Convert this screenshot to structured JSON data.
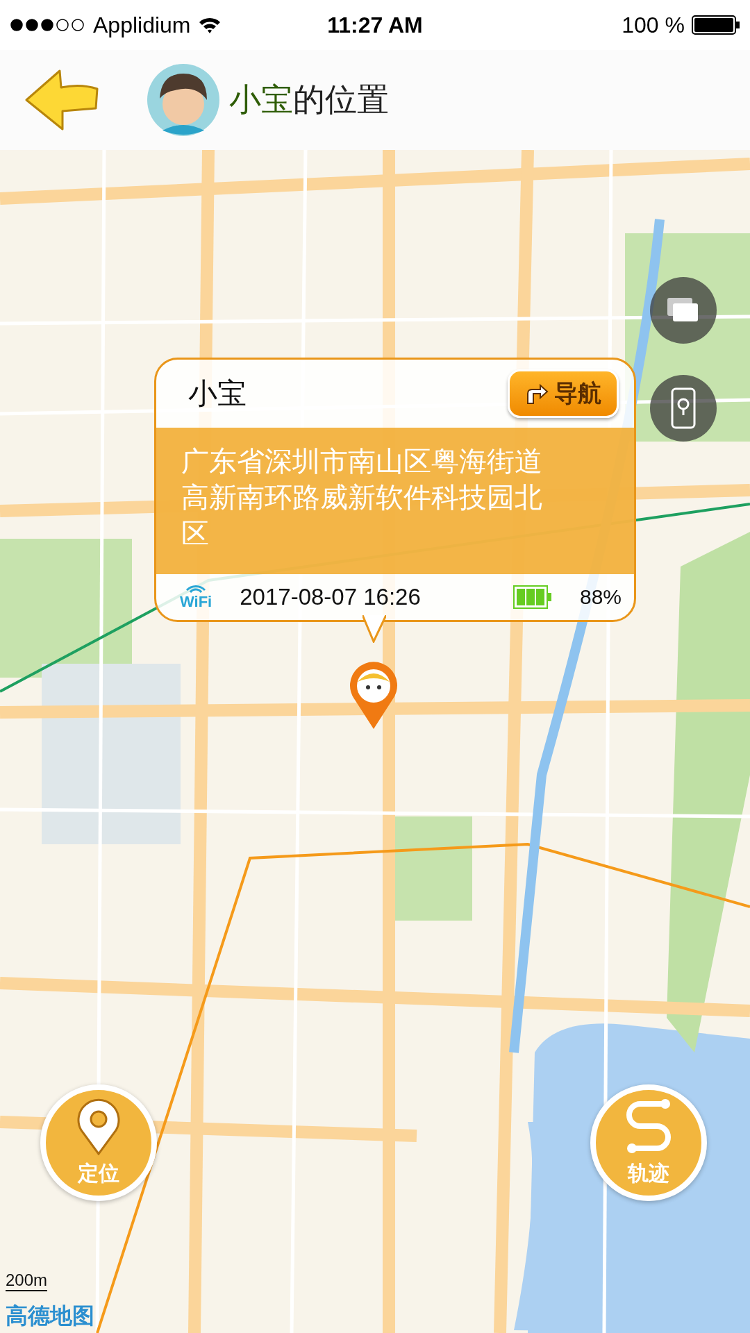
{
  "status_bar": {
    "carrier": "Applidium",
    "time": "11:27 AM",
    "battery": "100 %"
  },
  "header": {
    "title_name": "小宝",
    "title_suffix": "的位置"
  },
  "callout": {
    "name": "小宝",
    "nav_button": "导航",
    "address": "广东省深圳市南山区粤海街道高新南环路威新软件科技园北区",
    "network": "WiFi",
    "datetime": "2017-08-07  16:26",
    "battery": "88%"
  },
  "buttons": [
    {
      "kind": "locate",
      "label": "定位"
    },
    {
      "kind": "track",
      "label": "轨迹"
    }
  ],
  "map": {
    "scale": "200m",
    "logo": "高德地图"
  }
}
